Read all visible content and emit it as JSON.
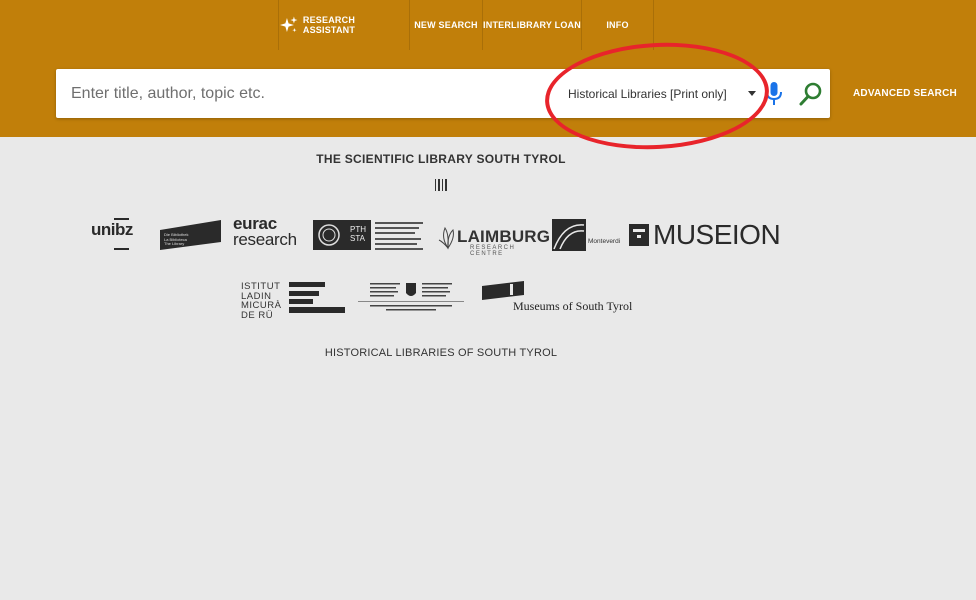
{
  "header": {
    "nav": [
      {
        "label": "RESEARCH ASSISTANT",
        "icon": "sparkle-icon"
      },
      {
        "label": "NEW SEARCH"
      },
      {
        "label": "INTERLIBRARY LOAN"
      },
      {
        "label": "INFO"
      }
    ],
    "search": {
      "placeholder": "Enter title, author, topic etc.",
      "value": "",
      "scope_selected": "Historical Libraries [Print only]"
    },
    "advanced_search_label": "ADVANCED SEARCH",
    "colors": {
      "header_bg": "#c17f0a",
      "mic_icon": "#1a73e8",
      "search_icon": "#2e7d32",
      "highlight_circle": "#e8242b"
    }
  },
  "main": {
    "title": "THE SCIENTIFIC LIBRARY SOUTH TYROL",
    "footer_label": "HISTORICAL LIBRARIES OF SOUTH TYROL",
    "logos": {
      "unibz": "unibz",
      "eurac_line1": "eurac",
      "eurac_line2": "research",
      "bibl_lines": [
        "Die Bibliothek",
        "La Biblioteca",
        "The Library"
      ],
      "pthsta_text": "PTH\nSTA",
      "laimburg_big": "LAIMBURG",
      "laimburg_small": "RESEARCH CENTRE",
      "monteverdi": "Monteverdi",
      "museion": "MUSEION",
      "istitut_lines": [
        "ISTITUT",
        "LADIN",
        "MICURÀ",
        "DE RÜ"
      ],
      "museums": "Museums of South Tyrol"
    }
  }
}
